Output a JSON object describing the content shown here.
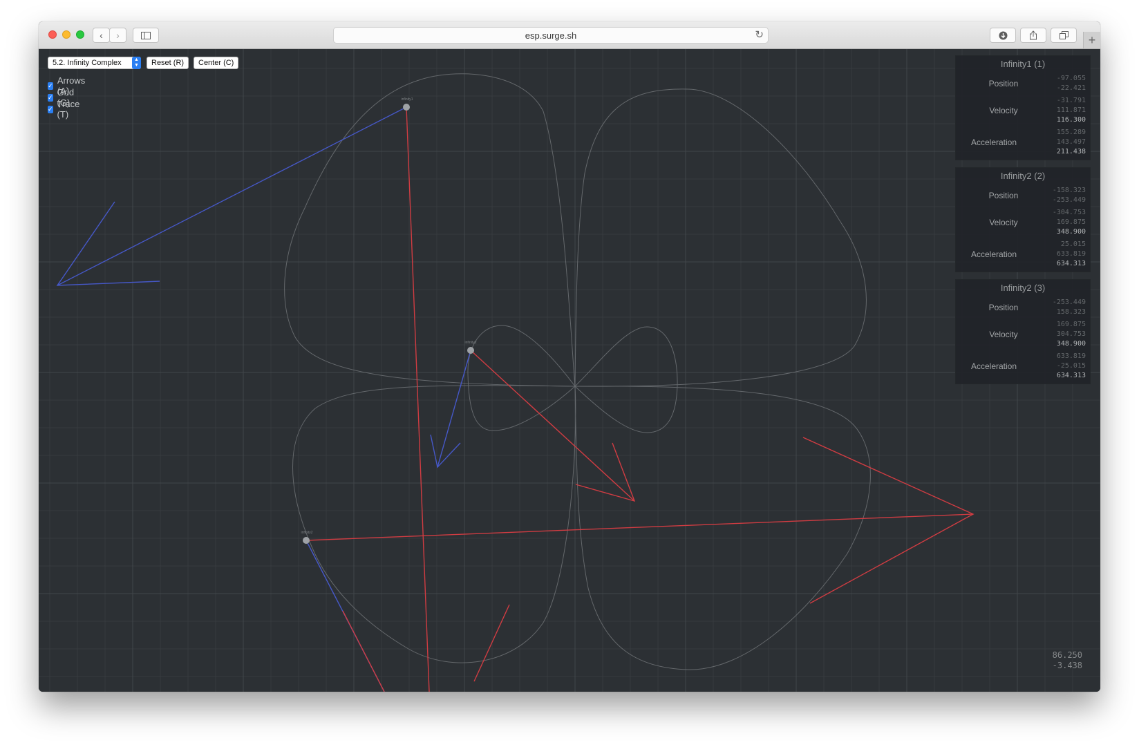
{
  "browser": {
    "url": "esp.surge.sh",
    "icons": {
      "back": "chevron-left-icon",
      "forward": "chevron-right-icon",
      "sidebar": "sidebar-icon",
      "reload": "reload-icon",
      "download": "download-icon",
      "share": "share-icon",
      "tabs": "tab-overview-icon",
      "new_tab": "plus-icon"
    }
  },
  "controls": {
    "scene_select": "5.2. Infinity Complex",
    "reset_label": "Reset (R)",
    "center_label": "Center (C)",
    "arrows_label": "Arrows (A)",
    "grid_label": "Grid (G)",
    "trace_label": "Trace (T)",
    "arrows_checked": true,
    "grid_checked": true,
    "trace_checked": true
  },
  "panels": [
    {
      "title": "Infinity1 (1)",
      "position_label": "Position",
      "position": [
        "-97.055",
        "-22.421"
      ],
      "velocity_label": "Velocity",
      "velocity": [
        "-31.791",
        "111.871",
        "116.300"
      ],
      "acceleration_label": "Acceleration",
      "acceleration": [
        "155.289",
        "143.497",
        "211.438"
      ]
    },
    {
      "title": "Infinity2 (2)",
      "position_label": "Position",
      "position": [
        "-158.323",
        "-253.449"
      ],
      "velocity_label": "Velocity",
      "velocity": [
        "-304.753",
        "169.875",
        "348.900"
      ],
      "acceleration_label": "Acceleration",
      "acceleration": [
        "25.015",
        "633.819",
        "634.313"
      ]
    },
    {
      "title": "Infinity2 (3)",
      "position_label": "Position",
      "position": [
        "-253.449",
        "158.323"
      ],
      "velocity_label": "Velocity",
      "velocity": [
        "169.875",
        "304.753",
        "348.900"
      ],
      "acceleration_label": "Acceleration",
      "acceleration": [
        "633.819",
        "-25.015",
        "634.313"
      ]
    }
  ],
  "cursor_readout": [
    "86.250",
    "-3.438"
  ],
  "colors": {
    "background": "#2c3034",
    "grid_minor": "#363a3e",
    "grid_major": "#41464a",
    "trace": "#6e7276",
    "velocity_arrow": "#4658c8",
    "acceleration_arrow": "#d03c42",
    "body": "#9ea2a6",
    "accent": "#2a7ff3"
  }
}
